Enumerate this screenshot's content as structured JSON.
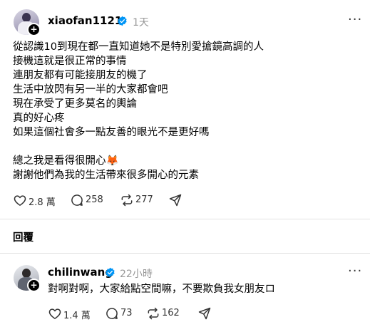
{
  "post": {
    "username": "xiaofan1121",
    "time": "1天",
    "body_lines": [
      "從認識10到現在都一直知道她不是特別愛搶鏡高調的人",
      "接機這就是很正常的事情",
      "連朋友都有可能接朋友的機了",
      "生活中放閃有另一半的大家都會吧",
      "現在承受了更多莫名的輿論",
      "真的好心疼",
      "如果這個社會多一點友善的眼光不是更好嗎"
    ],
    "body_lines_2": [
      "總之我是看得很開心🦊",
      "謝謝他們為我的生活帶來很多開心的元素"
    ],
    "likes": "2.8 萬",
    "comments": "258",
    "reposts": "277"
  },
  "section_label": "回覆",
  "reply": {
    "username": "chilinwang",
    "time": "22小時",
    "text": "對啊對啊，大家給點空間嘛，不要欺負我女朋友ロ",
    "likes": "1.4 萬",
    "comments": "73",
    "reposts": "162"
  },
  "colors": {
    "verified": "#0095f6",
    "muted": "#999999",
    "divider": "#e3e3e3"
  }
}
